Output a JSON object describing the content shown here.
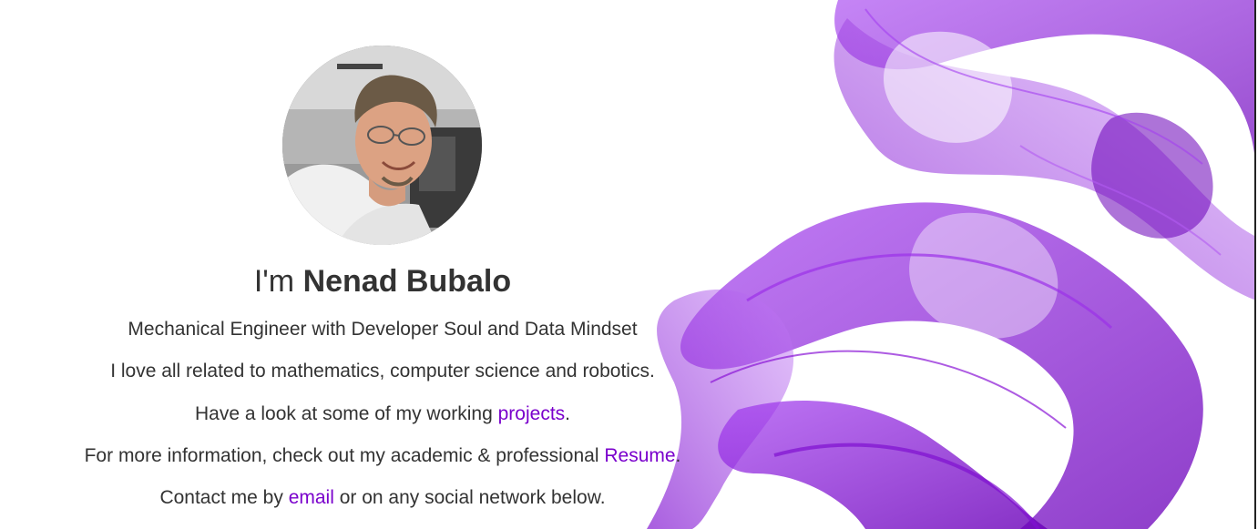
{
  "colors": {
    "link": "#7a00cc",
    "text": "#333333",
    "smoke": "#8a16d6"
  },
  "profile": {
    "avatar_icon": "profile-photo",
    "heading_prefix": "I'm ",
    "name": "Nenad Bubalo",
    "tagline": "Mechanical Engineer with Developer Soul and Data Mindset",
    "interests": "I love all related to mathematics, computer science and robotics.",
    "projects_prefix": "Have a look at some of my working ",
    "projects_link": "projects",
    "projects_suffix": ".",
    "resume_prefix": "For more information, check out my academic & professional ",
    "resume_link": "Resume",
    "resume_suffix": ".",
    "contact_prefix": "Contact me by ",
    "contact_link": "email",
    "contact_suffix": " or on any social network below."
  },
  "background": {
    "image_icon": "purple-smoke-image"
  }
}
